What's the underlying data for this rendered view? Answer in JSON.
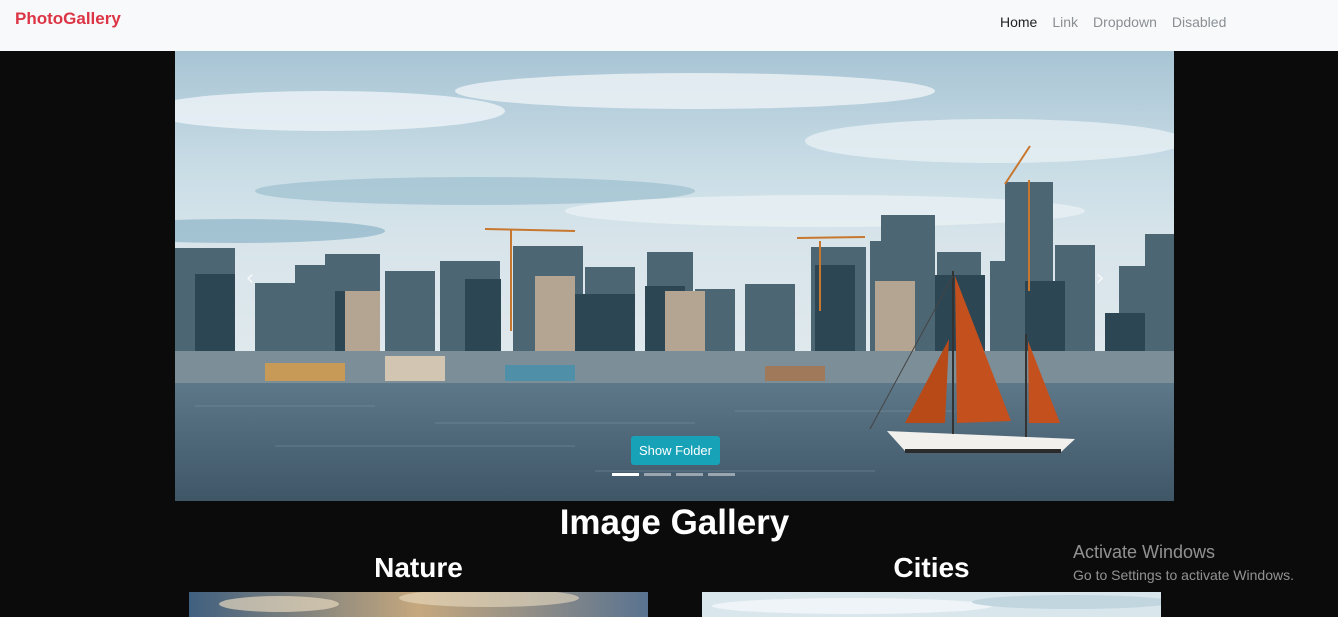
{
  "navbar": {
    "brand": "PhotoGallery",
    "links": [
      "Home",
      "Link",
      "Dropdown",
      "Disabled"
    ],
    "active": "Home"
  },
  "carousel": {
    "prev_icon": "chevron-left-icon",
    "next_icon": "chevron-right-icon",
    "button_label": "Show Folder",
    "slides": 4,
    "active_slide": 1
  },
  "gallery": {
    "title": "Image Gallery",
    "categories": [
      "Nature",
      "Cities"
    ]
  },
  "watermark": {
    "line1": "Activate Windows",
    "line2": "Go to Settings to activate Windows."
  },
  "colors": {
    "brand": "#dc3545",
    "button": "#17a2b8",
    "background": "#0b0b0c",
    "navbar": "#f8f9fa"
  }
}
